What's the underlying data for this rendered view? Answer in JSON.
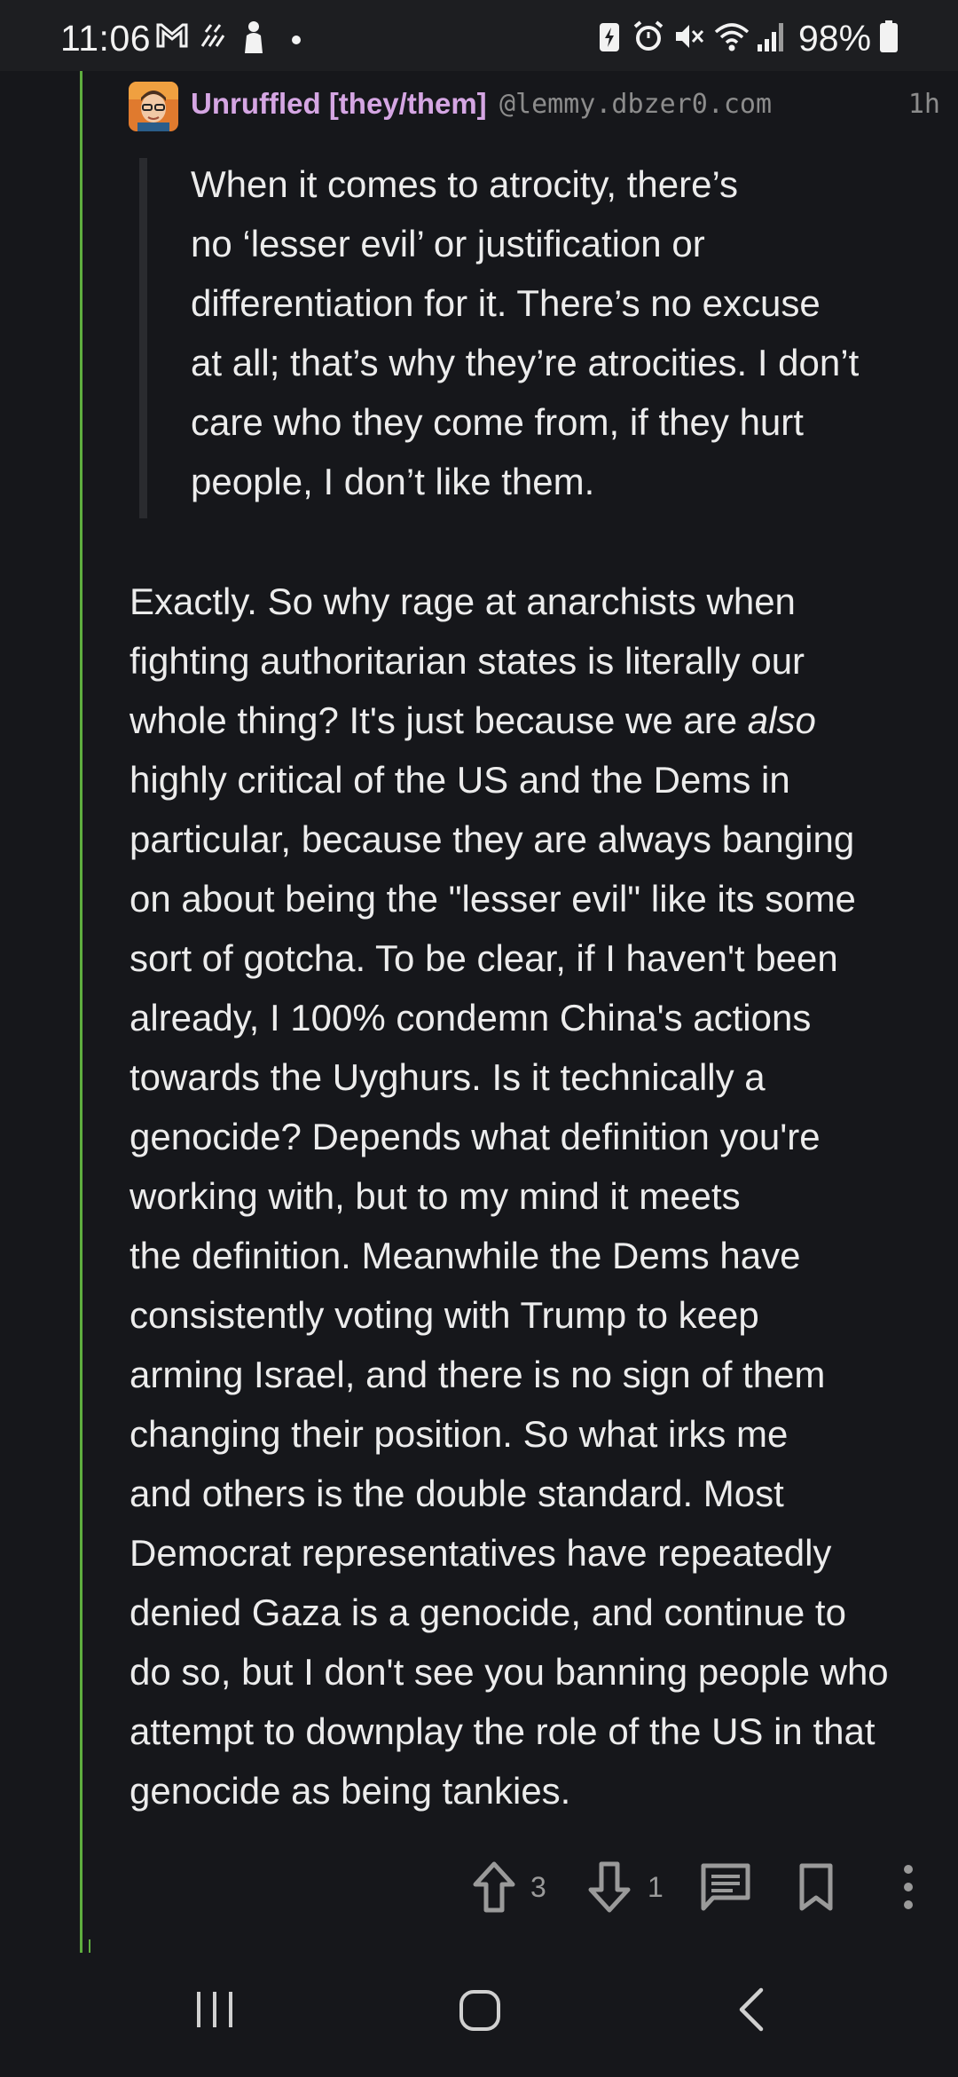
{
  "status_bar": {
    "time": "11:06",
    "battery_percent": "98%",
    "icons": [
      "gmail-icon",
      "weather-icon",
      "figure-icon",
      "dot-icon",
      "battery-saver-icon",
      "alarm-icon",
      "mute-icon",
      "wifi-icon",
      "signal-icon",
      "battery-icon"
    ]
  },
  "comment": {
    "author": "Unruffled [they/them]",
    "instance": "@lemmy.dbzer0.com",
    "age": "1h",
    "quote_lines": [
      "When it comes to atrocity, there’s",
      "no ‘lesser evil’ or justification or",
      "differentiation for it. There’s no excuse",
      "at all; that’s why they’re atrocities. I don’t",
      "care who they come from, if they hurt",
      "people, I don’t like them."
    ],
    "body_lines": [
      "Exactly. So why rage at anarchists when",
      "fighting authoritarian states is literally our",
      "whole thing? It's just because we are ",
      "highly critical of the US and the Dems in",
      "particular, because they are always banging",
      "on about being the \"lesser evil\" like its some",
      "sort of gotcha. To be clear, if I haven't been",
      "already, I 100% condemn China's actions",
      "towards the Uyghurs. Is it technically a",
      "genocide? Depends what definition you're",
      "working with, but to my mind it meets",
      "the definition. Meanwhile the Dems have",
      "consistently voting with Trump to keep",
      "arming Israel, and there is no sign of them",
      "changing their position. So what irks me",
      "and others is the double standard. Most",
      "Democrat representatives have repeatedly",
      "denied Gaza is a genocide, and continue to",
      "do so, but I don't see you banning people who",
      "attempt to downplay the role of the US in that",
      "genocide as being tankies."
    ],
    "body_emphasis": "also",
    "upvotes": "3",
    "downvotes": "1"
  },
  "colors": {
    "background": "#16171b",
    "author": "#d5a6e3",
    "thread_line": "#5fae3f",
    "muted": "#8c8c8c"
  },
  "nav_bar": {
    "buttons": [
      "recent-apps-icon",
      "home-icon",
      "back-icon"
    ]
  }
}
